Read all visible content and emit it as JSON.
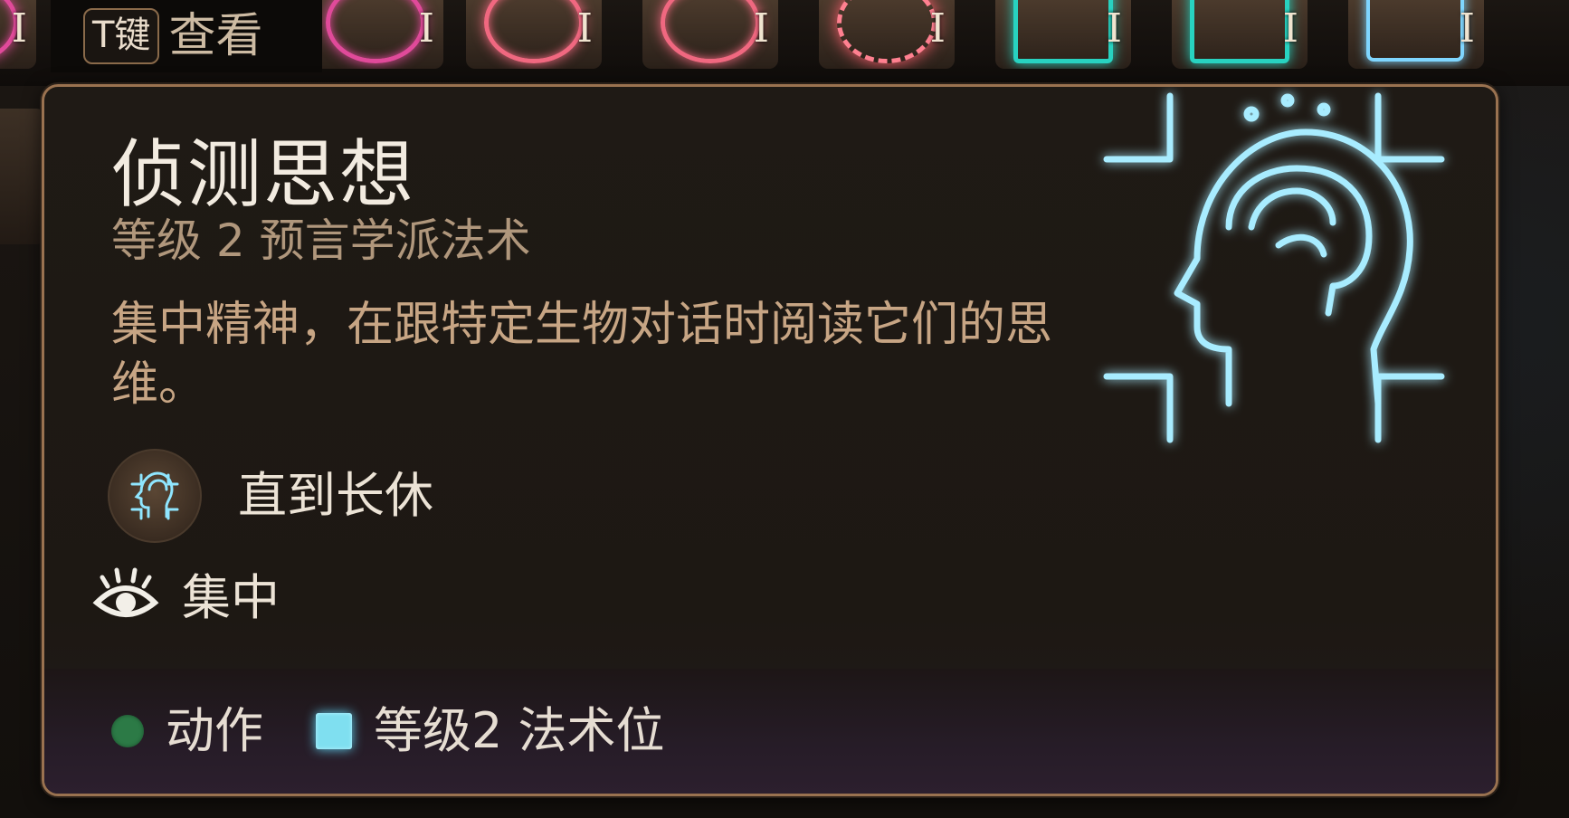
{
  "hotbar": {
    "key_badge": "T键",
    "key_label": "查看",
    "slots": [
      {
        "level": "I",
        "icon": "spell-rune-icon"
      },
      {
        "level": "I",
        "icon": "charm-rune-icon"
      },
      {
        "level": "I",
        "icon": "spiral-rune-icon"
      },
      {
        "level": "I",
        "icon": "eye-rune-icon"
      },
      {
        "level": "I",
        "icon": "starburst-rune-icon"
      },
      {
        "level": "I",
        "icon": "ward-rune-icon"
      },
      {
        "level": "I",
        "icon": "glyph-rune-icon"
      },
      {
        "level": "I",
        "icon": "mask-rune-icon"
      }
    ]
  },
  "tooltip": {
    "title": "侦测思想",
    "subtitle": "等级 2 预言学派法术",
    "description": "集中精神，在跟特定生物对话时阅读它们的思维。",
    "duration": {
      "icon": "head-mind-icon",
      "text": "直到长休"
    },
    "concentration": {
      "icon": "eye-concentration-icon",
      "text": "集中"
    },
    "costs": [
      {
        "icon": "action-dot-icon",
        "label": "动作",
        "color": "#2c7a46"
      },
      {
        "icon": "spell-slot-icon",
        "label": "等级2 法术位",
        "color": "#7fdff0"
      }
    ],
    "art_icon": "detect-thoughts-head-icon",
    "colors": {
      "border": "#9a7250",
      "title": "#f2ebe0",
      "subtitle": "#b0977c",
      "description": "#c7a584",
      "glow": "#8fe6ff"
    }
  }
}
